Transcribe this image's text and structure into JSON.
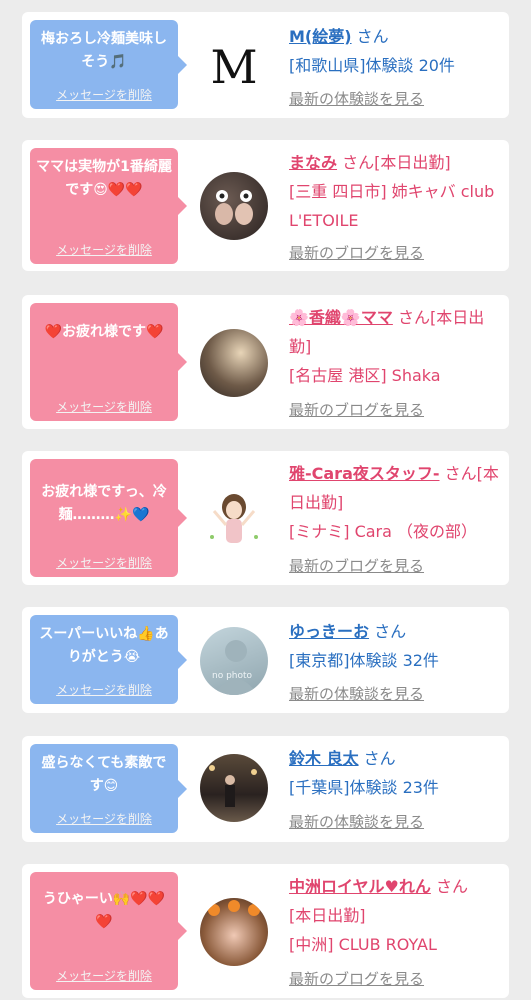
{
  "delete_label": "メッセージを削除",
  "cards": [
    {
      "message": "梅おろし冷麺美味しそう🎵",
      "name": "M(絵夢)",
      "suffix": "さん",
      "line1": "[和歌山県]体験談 20件",
      "link": "最新の体験談を見る",
      "avatar_text": "M"
    },
    {
      "message": "ママは実物が1番綺麗です😍❤️❤️",
      "name": "まなみ",
      "suffix": "さん[本日出勤]",
      "line1": "[三重 四日市] 姉キャバ club L'ETOILE",
      "link": "最新のブログを見る"
    },
    {
      "message": "❤️お疲れ様です❤️",
      "name": "🌸香織🌸ママ",
      "suffix": "さん[本日出勤]",
      "line1": "[名古屋 港区] Shaka",
      "link": "最新のブログを見る"
    },
    {
      "message": "お疲れ様ですっ、冷麺………✨💙",
      "name": "雅-Cara夜スタッフ-",
      "suffix": "さん[本日出勤]",
      "line1": "[ミナミ] Cara （夜の部）",
      "link": "最新のブログを見る"
    },
    {
      "message": "スーパーいいね👍ありがとう😭",
      "name": "ゆっきーお",
      "suffix": "さん",
      "line1": "[東京都]体験談 32件",
      "link": "最新の体験談を見る",
      "avatar_text": "no photo"
    },
    {
      "message": "盛らなくても素敵です😊",
      "name": "鈴木 良太",
      "suffix": "さん",
      "line1": "[千葉県]体験談 23件",
      "link": "最新の体験談を見る"
    },
    {
      "message": "うひゃーい🙌❤️❤️❤️",
      "name": "中洲ロイヤル♥れん",
      "suffix": "さん",
      "line1": "[本日出勤]",
      "line2": "[中洲] CLUB ROYAL",
      "link": "最新のブログを見る"
    }
  ]
}
